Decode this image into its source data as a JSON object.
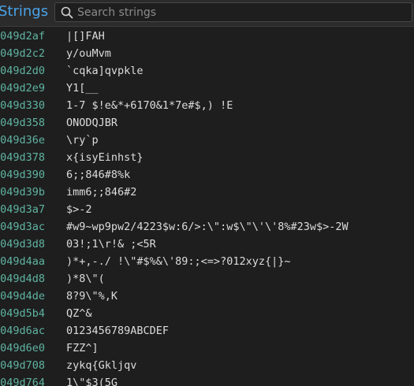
{
  "panel": {
    "title": "Strings"
  },
  "search": {
    "placeholder": "Search strings",
    "value": ""
  },
  "rows": [
    {
      "address": "0049d2af",
      "text": "|[]FAH"
    },
    {
      "address": "0049d2c2",
      "text": "y/ouMvm"
    },
    {
      "address": "0049d2d0",
      "text": "`cqka]qvpkle"
    },
    {
      "address": "0049d2e9",
      "text": "Y1[__"
    },
    {
      "address": "0049d330",
      "text": "1-7 $!e&*+6170&1*7e#$,) !E"
    },
    {
      "address": "0049d358",
      "text": "ONODQJBR"
    },
    {
      "address": "0049d36e",
      "text": "\\ry`p"
    },
    {
      "address": "0049d378",
      "text": "x{isyEinhst}"
    },
    {
      "address": "0049d390",
      "text": "6;;846#8%k"
    },
    {
      "address": "0049d39b",
      "text": "imm6;;846#2"
    },
    {
      "address": "0049d3a7",
      "text": "$>-2"
    },
    {
      "address": "0049d3ac",
      "text": "#w9~wp9pw2/4223$w:6/>:\\\":w$\\\"\\'\\'8%#23w$>-2W"
    },
    {
      "address": "0049d3d8",
      "text": "03!;1\\r!& ;<5R"
    },
    {
      "address": "0049d4aa",
      "text": ")*+,-./ !\\\"#$%&\\'89:;<=>?012xyz{|}~"
    },
    {
      "address": "0049d4d8",
      "text": ")*8\\\"("
    },
    {
      "address": "0049d4de",
      "text": "8?9\\\"%,K"
    },
    {
      "address": "0049d5b4",
      "text": "QZ^&"
    },
    {
      "address": "0049d6ac",
      "text": "0123456789ABCDEF"
    },
    {
      "address": "0049d6e0",
      "text": "FZZ^]"
    },
    {
      "address": "0049d708",
      "text": "zykq{Gkljqv"
    },
    {
      "address": "0049d764",
      "text": "1\\\"$3(5G"
    }
  ]
}
